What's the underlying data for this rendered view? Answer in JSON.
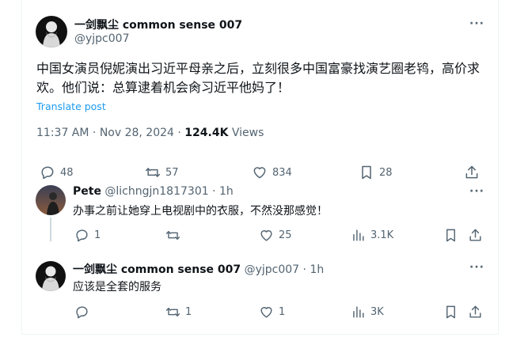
{
  "main_tweet": {
    "author_name": "一剑飘尘 common sense 007",
    "author_handle": "@yjpc007",
    "text": "中国女演员倪妮演出习近平母亲之后，立刻很多中国富豪找演艺圈老鸨，高价求欢。他们说：总算逮着机会肏习近平他妈了！",
    "translate_label": "Translate post",
    "time": "11:37 AM",
    "date": "Nov 28, 2024",
    "views_count": "124.4K",
    "views_label": "Views",
    "replies": "48",
    "reposts": "57",
    "likes": "834",
    "bookmarks": "28",
    "more_label": "···"
  },
  "replies": [
    {
      "author_name": "Pete",
      "author_handle": "@lichngjn1817301",
      "time": "1h",
      "text": "办事之前让她穿上电视剧中的衣服，不然没那感觉！",
      "replies": "1",
      "reposts": "",
      "likes": "25",
      "views": "3.1K",
      "more_label": "···"
    },
    {
      "author_name": "一剑飘尘 common sense 007",
      "author_handle": "@yjpc007",
      "time": "1h",
      "text": "应该是全套的服务",
      "replies": "",
      "reposts": "1",
      "likes": "1",
      "views": "3K",
      "more_label": "···"
    }
  ],
  "separator": "·",
  "icons": [
    "reply-icon",
    "repost-icon",
    "like-icon",
    "bookmark-icon",
    "share-icon",
    "views-icon",
    "more-icon"
  ],
  "colors": {
    "link": "#1d9bf0",
    "secondary": "#536471",
    "text": "#0f1419",
    "border": "#eff3f4"
  }
}
